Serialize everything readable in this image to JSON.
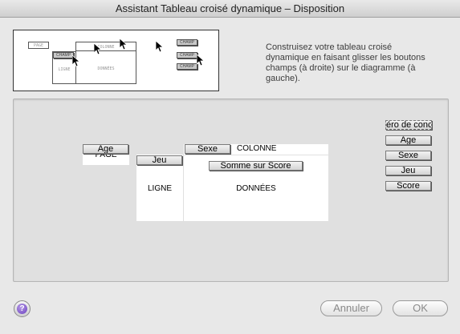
{
  "window": {
    "title": "Assistant Tableau croisé dynamique – Disposition"
  },
  "illustration": {
    "page_label": "PAGE",
    "colonne_label": "COLONNE",
    "ligne_label": "LIGNE",
    "donnees_label": "DONNÉES",
    "chips": [
      "CHAMP",
      "CHAMP",
      "CHAMP",
      "CHAMP"
    ]
  },
  "help_text": "Construisez votre tableau croisé dynamique en faisant glisser les boutons champs (à droite) sur le diagramme (à gauche).",
  "layout": {
    "page": {
      "label": "PAGE",
      "field": "Age"
    },
    "row": {
      "label": "LIGNE",
      "field": "Jeu"
    },
    "column": {
      "label": "COLONNE",
      "field": "Sexe"
    },
    "data": {
      "label": "DONNÉES",
      "field": "Somme sur Score"
    }
  },
  "field_list": [
    "éro de conc",
    "Age",
    "Sexe",
    "Jeu",
    "Score"
  ],
  "buttons": {
    "help": "?",
    "cancel": "Annuler",
    "ok": "OK"
  }
}
